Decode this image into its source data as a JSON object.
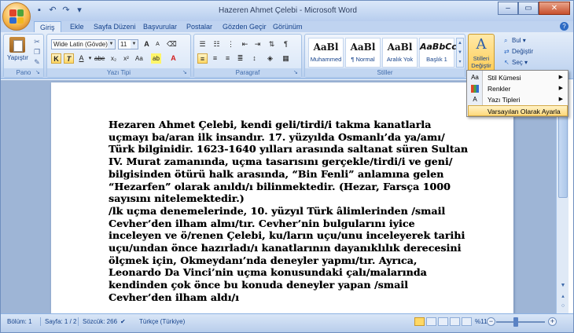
{
  "window": {
    "title": "Hazeren Ahmet Çelebi - Microsoft Word",
    "controls": {
      "minimize": "–",
      "maximize": "▭",
      "close": "✕"
    }
  },
  "quick_access": [
    "save-icon",
    "undo-icon",
    "redo-icon",
    "customize-icon"
  ],
  "tabs": [
    {
      "label": "Giriş",
      "active": true
    },
    {
      "label": "Ekle"
    },
    {
      "label": "Sayfa Düzeni"
    },
    {
      "label": "Başvurular"
    },
    {
      "label": "Postalar"
    },
    {
      "label": "Gözden Geçir"
    },
    {
      "label": "Görünüm"
    }
  ],
  "ribbon": {
    "clipboard": {
      "label": "Pano",
      "paste": "Yapıştır"
    },
    "font": {
      "label": "Yazı Tipi",
      "font_name": "Wide Latin (Gövde)",
      "font_size": "11",
      "bold": "K",
      "italic": "T",
      "underline": "A",
      "strike": "abe",
      "subscript": "x₂",
      "superscript": "x²",
      "case": "Aa",
      "grow": "A",
      "shrink": "A"
    },
    "paragraph": {
      "label": "Paragraf"
    },
    "styles": {
      "label": "Stiller",
      "items": [
        {
          "sample": "AaBl",
          "name": "Muhammed"
        },
        {
          "sample": "AaBl",
          "name": "¶ Normal"
        },
        {
          "sample": "AaBl",
          "name": "Aralık Yok"
        },
        {
          "sample": "AaBbCcl",
          "name": "Başlık 1"
        }
      ],
      "change_label_1": "Stilleri",
      "change_label_2": "Değiştir"
    },
    "editing": {
      "find": "Bul",
      "replace": "Değiştir",
      "select": "Seç"
    }
  },
  "menu": {
    "items": [
      {
        "label": "Stil Kümesi",
        "submenu": true
      },
      {
        "label": "Renkler",
        "submenu": true
      },
      {
        "label": "Yazı Tipleri",
        "submenu": true
      },
      {
        "label": "Varsayılan Olarak Ayarla",
        "submenu": false,
        "highlighted": true
      }
    ]
  },
  "document": {
    "paragraphs": [
      "Hezaren Ahmet Çelebi, kendi geli/tirdi/i takma kanatlarla uçmayı ba/aran ilk insandır. 17. yüzyılda Osmanlı’da ya/amı/ Türk bilginidir. 1623-1640 yılları arasında saltanat süren Sultan IV. Murat zamanında, uçma tasarısını gerçekle/tirdi/i ve geni/ bilgisinden ötürü halk arasında, “Bin Fenli” anlamına gelen “Hezarfen” olarak anıldı/ı bilinmektedir. (Hezar, Farsça 1000 sayısını nitelemektedir.)",
      "/lk uçma denemelerinde, 10. yüzyıl Türk âlimlerinden /smail Cevher’den ilham almı/tır. Cevher’nin bulgularını iyice inceleyen ve ö/renen Çelebi, ku/ların uçu/unu inceleyerek tarihi uçu/undan önce hazırladı/ı kanatlarının dayanıklılık derecesini ölçmek için, Okmeydanı’nda deneyler yapmı/tır. Ayrıca, Leonardo Da Vinci’nin uçma konusundaki çalı/malarında kendinden çok önce bu konuda deneyler yapan /smail Cevher’den ilham aldı/ı"
    ]
  },
  "status": {
    "section": "Bölüm: 1",
    "page": "Sayfa: 1 / 2",
    "words": "Sözcük: 266",
    "language": "Türkçe (Türkiye)",
    "zoom": "%110",
    "zoom_level_percent": 110
  },
  "colors": {
    "ribbon_text": "#15428b",
    "accent": "#ffd865",
    "workspace": "#9eb5d6"
  }
}
